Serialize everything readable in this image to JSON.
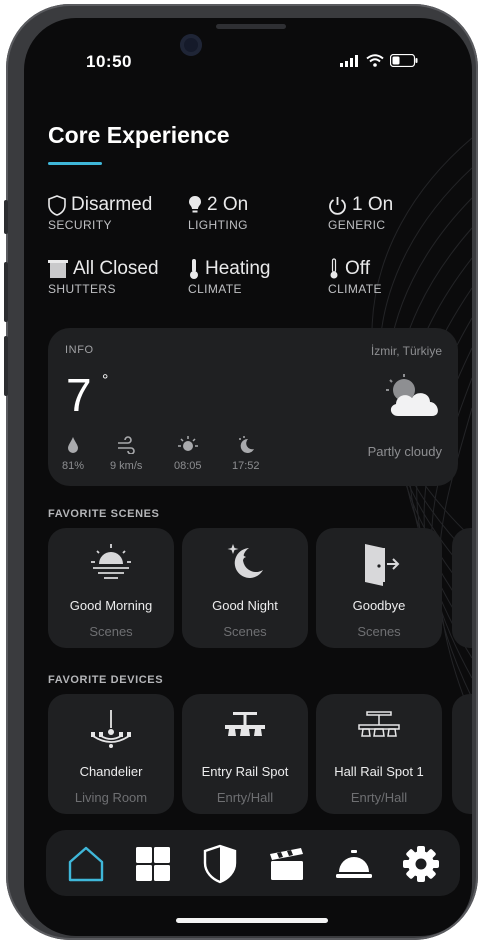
{
  "status_bar": {
    "time": "10:50"
  },
  "header": {
    "title": "Core Experience",
    "accent_color": "#3fb7d9"
  },
  "summary": [
    {
      "icon": "shield-icon",
      "value": "Disarmed",
      "label": "SECURITY"
    },
    {
      "icon": "lightbulb-icon",
      "value": "2 On",
      "label": "LIGHTING"
    },
    {
      "icon": "power-icon",
      "value": "1 On",
      "label": "GENERIC"
    },
    {
      "icon": "shutter-icon",
      "value": "All Closed",
      "label": "SHUTTERS"
    },
    {
      "icon": "thermometer-icon",
      "value": "Heating",
      "label": "CLIMATE"
    },
    {
      "icon": "thermometer-icon",
      "value": "Off",
      "label": "CLIMATE"
    }
  ],
  "info": {
    "label": "INFO",
    "location": "İzmir, Türkiye",
    "temperature": "7",
    "degree": "°",
    "condition": "Partly cloudy",
    "details": [
      {
        "icon": "humidity-drop-icon",
        "value": "81%"
      },
      {
        "icon": "wind-icon",
        "value": "9 km/s"
      },
      {
        "icon": "sunrise-icon",
        "value": "08:05"
      },
      {
        "icon": "sunset-icon",
        "value": "17:52"
      }
    ]
  },
  "favorite_scenes": {
    "label": "FAVORITE SCENES",
    "items": [
      {
        "icon": "sunrise-scene-icon",
        "name": "Good Morning",
        "sub": "Scenes"
      },
      {
        "icon": "moon-stars-icon",
        "name": "Good Night",
        "sub": "Scenes"
      },
      {
        "icon": "exit-door-icon",
        "name": "Goodbye",
        "sub": "Scenes"
      }
    ]
  },
  "favorite_devices": {
    "label": "FAVORITE DEVICES",
    "items": [
      {
        "icon": "chandelier-icon",
        "name": "Chandelier",
        "sub": "Living Room"
      },
      {
        "icon": "rail-spot-icon",
        "name": "Entry Rail Spot",
        "sub": "Enrty/Hall"
      },
      {
        "icon": "rail-spot-icon",
        "name": "Hall Rail Spot 1",
        "sub": "Enrty/Hall"
      }
    ]
  },
  "navigation": [
    {
      "icon": "home-icon",
      "active": true
    },
    {
      "icon": "grid-icon",
      "active": false
    },
    {
      "icon": "shield-icon",
      "active": false
    },
    {
      "icon": "clapperboard-icon",
      "active": false
    },
    {
      "icon": "service-bell-icon",
      "active": false
    },
    {
      "icon": "gear-icon",
      "active": false
    }
  ]
}
